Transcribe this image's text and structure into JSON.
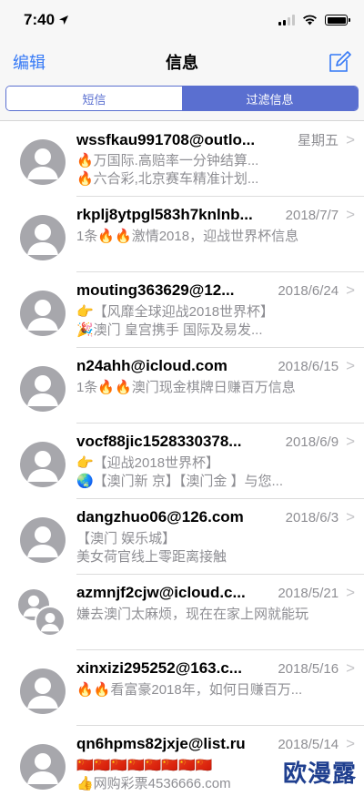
{
  "status": {
    "time": "7:40"
  },
  "nav": {
    "edit_label": "编辑",
    "title": "信息"
  },
  "segments": [
    {
      "label": "短信",
      "active": false
    },
    {
      "label": "过滤信息",
      "active": true
    }
  ],
  "messages": [
    {
      "sender": "wssfkau991708@outlo...",
      "date": "星期五",
      "preview1": "🔥万国际.高赔率一分钟结算...",
      "preview2": "🔥六合彩,北京赛车精准计划..."
    },
    {
      "sender": "rkplj8ytpgl583h7knlnb...",
      "date": "2018/7/7",
      "preview1": "1条🔥🔥激情2018，迎战世界杯信息",
      "preview2": ""
    },
    {
      "sender": "mouting363629@12...",
      "date": "2018/6/24",
      "preview1": "👉【风靡全球迎战2018世界杯】",
      "preview2": "🎉澳门 皇宫携手 国际及易发..."
    },
    {
      "sender": "n24ahh@icloud.com",
      "date": "2018/6/15",
      "preview1": "1条🔥🔥澳门现金棋牌日赚百万信息",
      "preview2": ""
    },
    {
      "sender": "vocf88jic1528330378...",
      "date": "2018/6/9",
      "preview1": "👉【迎战2018世界杯】",
      "preview2": "🌏【澳门新 京】【澳门金 】与您..."
    },
    {
      "sender": "dangzhuo06@126.com",
      "date": "2018/6/3",
      "preview1": "【澳门 娱乐城】",
      "preview2": "美女荷官线上零距离接触"
    },
    {
      "sender": "azmnjf2cjw@icloud.c...",
      "date": "2018/5/21",
      "preview1": "嫌去澳门太麻烦，现在在家上网就能玩",
      "preview2": "",
      "group": true
    },
    {
      "sender": "xinxizi295252@163.c...",
      "date": "2018/5/16",
      "preview1": "🔥🔥看富豪2018年，如何日赚百万...",
      "preview2": ""
    },
    {
      "sender": "qn6hpms82jxje@list.ru",
      "date": "2018/5/14",
      "preview1": "🇨🇳🇨🇳🇨🇳🇨🇳🇨🇳🇨🇳🇨🇳🇨🇳",
      "preview2": "👍网购彩票4536666.com"
    }
  ],
  "watermark": "欧漫露"
}
